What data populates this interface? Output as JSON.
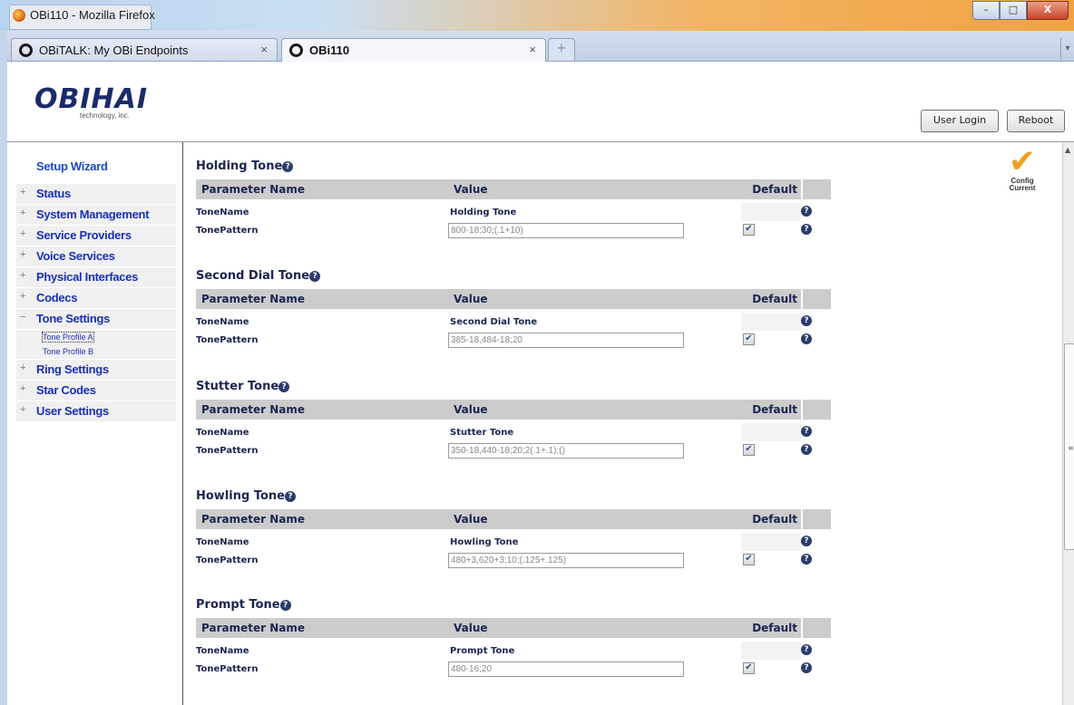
{
  "window": {
    "title": "OBi110 - Mozilla Firefox",
    "buttons": {
      "minimize": "–",
      "maximize": "□",
      "close": "X"
    }
  },
  "tabs": [
    {
      "label": "OBiTALK: My OBi Endpoints",
      "close": "×",
      "active": false
    },
    {
      "label": "OBi110",
      "close": "×",
      "active": true
    }
  ],
  "new_tab": "+",
  "header": {
    "logo": "OBIHAI",
    "logo_sub": "technology, inc.",
    "user_login": "User Login",
    "reboot": "Reboot"
  },
  "sidebar": {
    "setup_wizard": "Setup Wizard",
    "items": [
      {
        "pm": "+",
        "label": "Status"
      },
      {
        "pm": "+",
        "label": "System Management"
      },
      {
        "pm": "+",
        "label": "Service Providers"
      },
      {
        "pm": "+",
        "label": "Voice Services"
      },
      {
        "pm": "+",
        "label": "Physical Interfaces"
      },
      {
        "pm": "+",
        "label": "Codecs"
      },
      {
        "pm": "−",
        "label": "Tone Settings"
      },
      {
        "pm": "+",
        "label": "Ring Settings"
      },
      {
        "pm": "+",
        "label": "Star Codes"
      },
      {
        "pm": "+",
        "label": "User Settings"
      }
    ],
    "sub_items": [
      {
        "label": "Tone Profile A"
      },
      {
        "label": "Tone Profile B"
      }
    ]
  },
  "config_status": {
    "line1": "Config",
    "line2": "Current"
  },
  "table_headers": {
    "name": "Parameter Name",
    "value": "Value",
    "default": "Default"
  },
  "help_glyph": "?",
  "sections": [
    {
      "title": "Holding Tone",
      "tone_name_label": "ToneName",
      "tone_name": "Holding Tone",
      "pattern_label": "TonePattern",
      "pattern": "800-18;30;(.1+10)",
      "default_checked": true
    },
    {
      "title": "Second Dial Tone",
      "tone_name_label": "ToneName",
      "tone_name": "Second Dial Tone",
      "pattern_label": "TonePattern",
      "pattern": "385-18,484-18;20",
      "default_checked": true
    },
    {
      "title": "Stutter Tone",
      "tone_name_label": "ToneName",
      "tone_name": "Stutter Tone",
      "pattern_label": "TonePattern",
      "pattern": "350-18,440-18;20;2(.1+.1);()",
      "default_checked": true
    },
    {
      "title": "Howling Tone",
      "tone_name_label": "ToneName",
      "tone_name": "Howling Tone",
      "pattern_label": "TonePattern",
      "pattern": "480+3,620+3;10;(.125+.125)",
      "default_checked": true
    },
    {
      "title": "Prompt Tone",
      "tone_name_label": "ToneName",
      "tone_name": "Prompt Tone",
      "pattern_label": "TonePattern",
      "pattern": "480-16;20",
      "default_checked": true
    }
  ],
  "colors": {
    "nav_link": "#1830b8",
    "section_title": "#1a2550",
    "header_bg": "#cccccc"
  }
}
